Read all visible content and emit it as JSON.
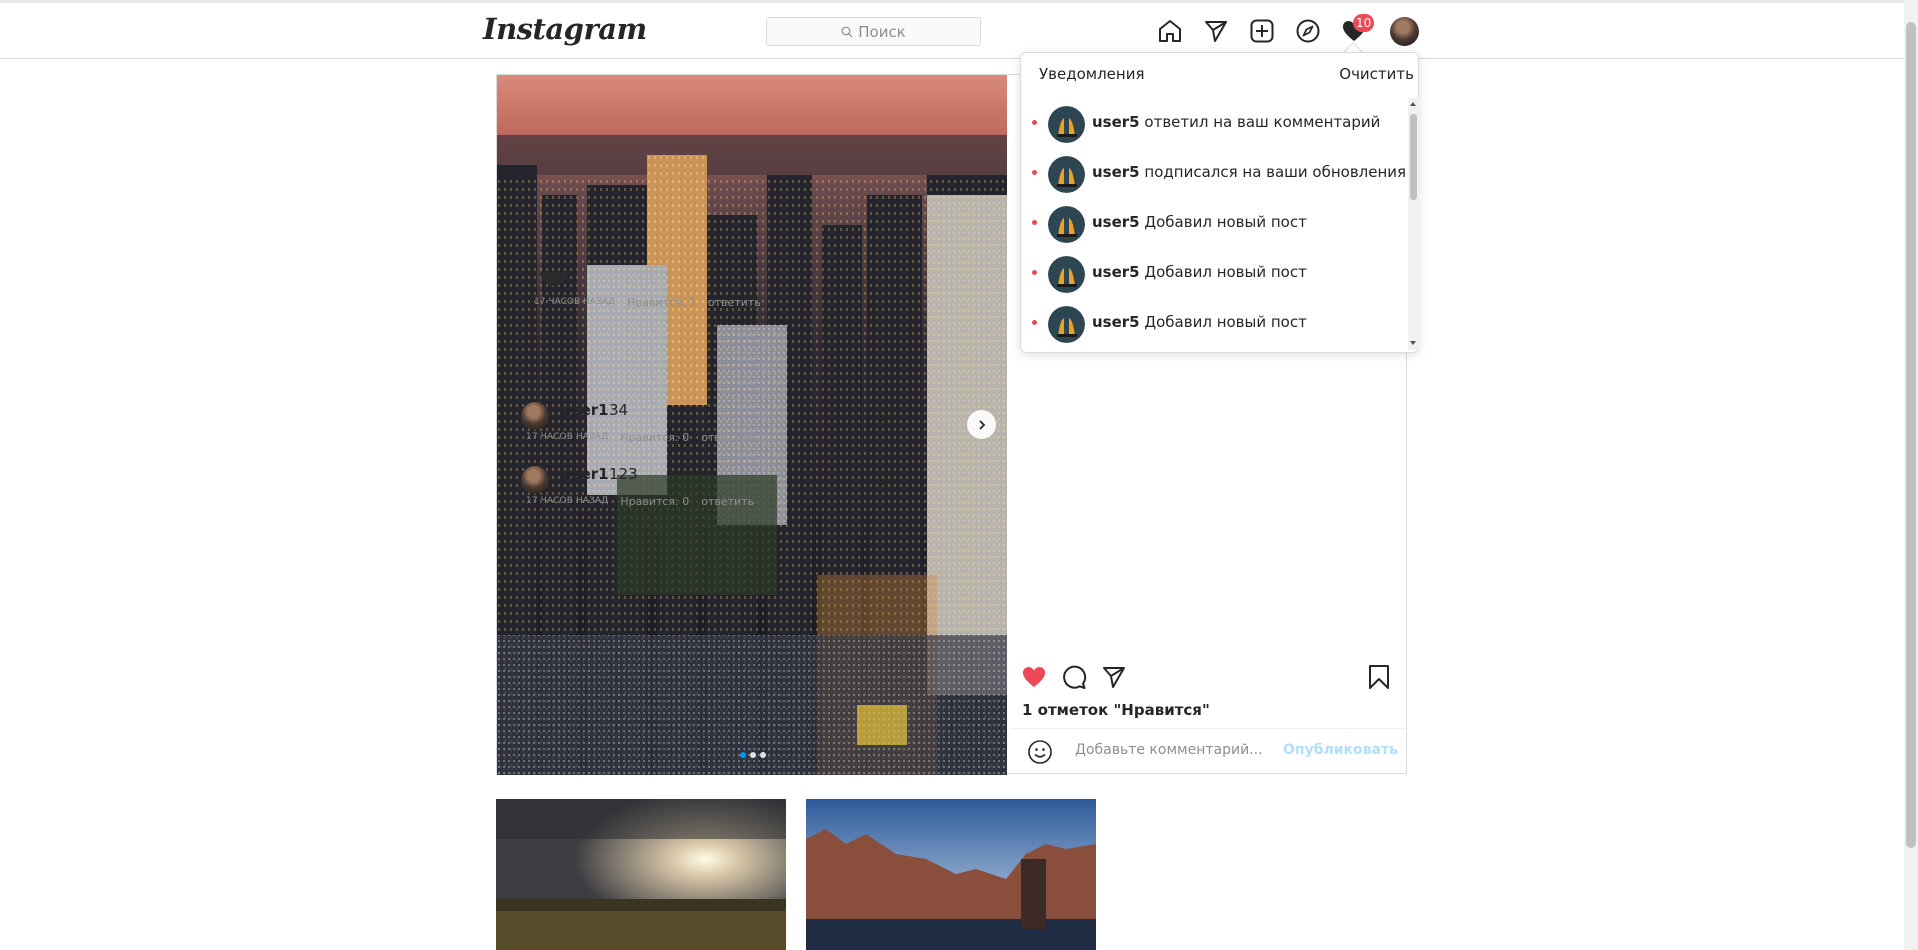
{
  "app": {
    "logo": "Instagram",
    "search_placeholder": "Поиск",
    "notification_count": "10"
  },
  "notifications": {
    "title": "Уведомления",
    "clear_label": "Очистить",
    "items": [
      {
        "user": "user5",
        "text": "ответил на ваш комментарий"
      },
      {
        "user": "user5",
        "text": "подписался на ваши обновления"
      },
      {
        "user": "user5",
        "text": "Добавил новый пост"
      },
      {
        "user": "user5",
        "text": "Добавил новый пост"
      },
      {
        "user": "user5",
        "text": "Добавил новый пост"
      }
    ]
  },
  "post": {
    "partial_comment": {
      "time": "17 часов назад",
      "likes": "Нравится: 1",
      "reply": "ответить"
    },
    "comments": [
      {
        "user": "user1",
        "text": "34",
        "time": "17 часов назад",
        "likes": "Нравится: 0",
        "reply": "ответить"
      },
      {
        "user": "user1",
        "text": "123",
        "time": "17 часов назад",
        "likes": "Нравится: 0",
        "reply": "ответить"
      }
    ],
    "likes_text": "1 отметок  \"Нравится\"",
    "comment_placeholder": "Добавьте комментарий...",
    "publish_label": "Опубликовать",
    "carousel": {
      "total": 3,
      "active_index": 0
    }
  },
  "colors": {
    "accent": "#0095f6",
    "like": "#ed4956",
    "publish_disabled": "#b2dffc"
  }
}
